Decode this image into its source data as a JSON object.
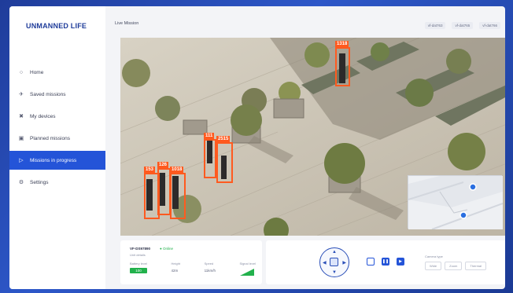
{
  "app": {
    "logo": "UNMANNED LIFE"
  },
  "sidebar": {
    "items": [
      {
        "label": "Home",
        "icon": "home-icon",
        "glyph": "○"
      },
      {
        "label": "Saved missions",
        "icon": "drone-icon",
        "glyph": "✈"
      },
      {
        "label": "My devices",
        "icon": "devices-icon",
        "glyph": "✖"
      },
      {
        "label": "Planned missions",
        "icon": "calendar-icon",
        "glyph": "▣"
      },
      {
        "label": "Missions in progress",
        "icon": "play-icon",
        "glyph": "▷"
      },
      {
        "label": "Settings",
        "icon": "gear-icon",
        "glyph": "⚙"
      }
    ],
    "active_index": 4
  },
  "header": {
    "title": "Live Mission",
    "buttons": [
      "vf-dat763",
      "vf-dat765",
      "vf-dat766"
    ]
  },
  "video": {
    "detections": [
      {
        "label": "1318"
      },
      {
        "label": "111"
      },
      {
        "label": "2515"
      },
      {
        "label": "153"
      },
      {
        "label": "126"
      },
      {
        "label": "1018"
      }
    ]
  },
  "info": {
    "device_id": "VF-DS97890",
    "status": "Online",
    "sub": "Unit details",
    "fields": [
      {
        "label": "Battery level",
        "value": "100"
      },
      {
        "label": "Height",
        "value": "42m"
      },
      {
        "label": "Speed",
        "value": "11km/h"
      },
      {
        "label": "Signal level",
        "value": ""
      }
    ]
  },
  "controls": {
    "camera_label": "Camera type",
    "camera_options": [
      "Wide",
      "Zoom",
      "Thermal"
    ]
  },
  "colors": {
    "accent": "#2454d8",
    "detection": "#ff5a1f",
    "online": "#22b14c"
  }
}
